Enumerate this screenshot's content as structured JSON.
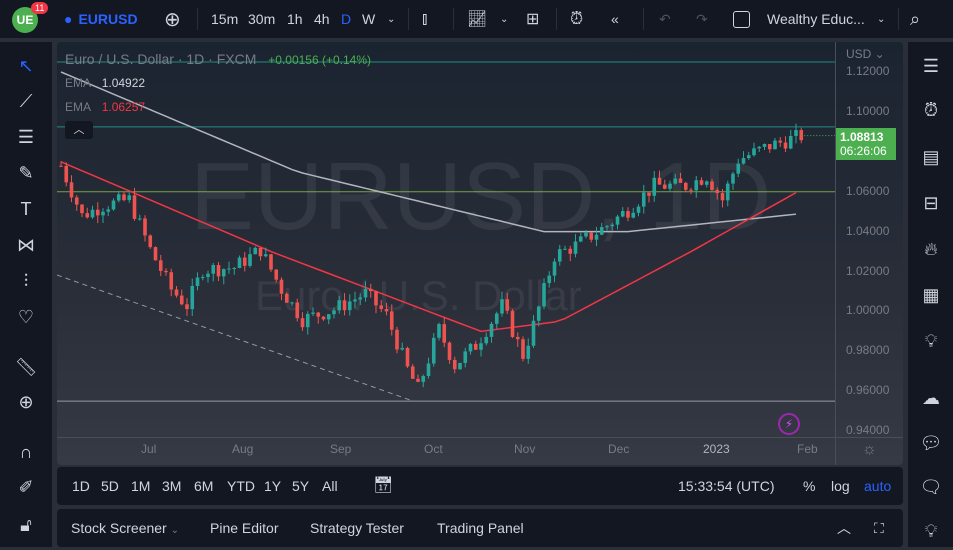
{
  "toolbar": {
    "notif_count": "11",
    "symbol": "EURUSD",
    "intervals": [
      "15m",
      "30m",
      "1h",
      "4h",
      "D",
      "W"
    ],
    "active_interval": "D",
    "layout_name": "Wealthy Educ..."
  },
  "legend": {
    "title": "Euro / U.S. Dollar · 1D · FXCM",
    "change": "+0.00156 (+0.14%)",
    "ema1_label": "EMA",
    "ema1_value": "1.04922",
    "ema2_label": "EMA",
    "ema2_value": "1.06257"
  },
  "watermark": {
    "line1": "EURUSD, 1D",
    "line2": "Euro / U.S. Dollar"
  },
  "price_axis": {
    "currency": "USD",
    "labels": [
      "1.12000",
      "1.10000",
      "1.06000",
      "1.04000",
      "1.02000",
      "1.00000",
      "0.98000",
      "0.96000",
      "0.94000"
    ],
    "last_price": "1.08813",
    "countdown": "06:26:06"
  },
  "time_axis": {
    "labels": [
      "Jul",
      "Aug",
      "Sep",
      "Oct",
      "Nov",
      "Dec",
      "2023",
      "Feb"
    ]
  },
  "ranges": [
    "1D",
    "5D",
    "1M",
    "3M",
    "6M",
    "YTD",
    "1Y",
    "5Y",
    "All"
  ],
  "status": {
    "time": "15:33:54 (UTC)",
    "percent": "%",
    "log": "log",
    "auto": "auto"
  },
  "panels": {
    "stock_screener": "Stock Screener",
    "pine_editor": "Pine Editor",
    "strategy_tester": "Strategy Tester",
    "trading_panel": "Trading Panel"
  },
  "colors": {
    "up": "#26a69a",
    "down": "#ef5350",
    "accent": "#2962ff",
    "last": "#4caf50"
  },
  "chart_data": {
    "type": "candlestick",
    "ylim": [
      0.935,
      1.13
    ],
    "anchors": [
      [
        0,
        1.073
      ],
      [
        4,
        1.048
      ],
      [
        8,
        1.053
      ],
      [
        13,
        1.056
      ],
      [
        17,
        1.031
      ],
      [
        21,
        1.011
      ],
      [
        24,
        1.003
      ],
      [
        27,
        1.021
      ],
      [
        33,
        1.022
      ],
      [
        38,
        1.031
      ],
      [
        42,
        1.011
      ],
      [
        46,
        0.996
      ],
      [
        52,
        1.001
      ],
      [
        58,
        1.009
      ],
      [
        62,
        0.998
      ],
      [
        66,
        0.971
      ],
      [
        68,
        0.961
      ],
      [
        72,
        0.991
      ],
      [
        75,
        0.973
      ],
      [
        79,
        0.983
      ],
      [
        84,
        1.003
      ],
      [
        88,
        0.978
      ],
      [
        90,
        0.993
      ],
      [
        94,
        1.028
      ],
      [
        98,
        1.033
      ],
      [
        104,
        1.043
      ],
      [
        108,
        1.051
      ],
      [
        113,
        1.063
      ],
      [
        119,
        1.063
      ],
      [
        123,
        1.068
      ],
      [
        126,
        1.056
      ],
      [
        129,
        1.076
      ],
      [
        135,
        1.083
      ],
      [
        141,
        1.088
      ]
    ],
    "ema_red": [
      [
        0,
        1.075
      ],
      [
        40,
        1.03
      ],
      [
        80,
        0.99
      ],
      [
        95,
        0.995
      ],
      [
        120,
        1.03
      ],
      [
        141,
        1.061
      ]
    ],
    "ema_white": [
      [
        0,
        1.12
      ],
      [
        45,
        1.07
      ],
      [
        92,
        1.04
      ],
      [
        108,
        1.04
      ],
      [
        141,
        1.049
      ]
    ],
    "hlines": [
      1.125,
      1.0925,
      1.06,
      0.955
    ]
  }
}
